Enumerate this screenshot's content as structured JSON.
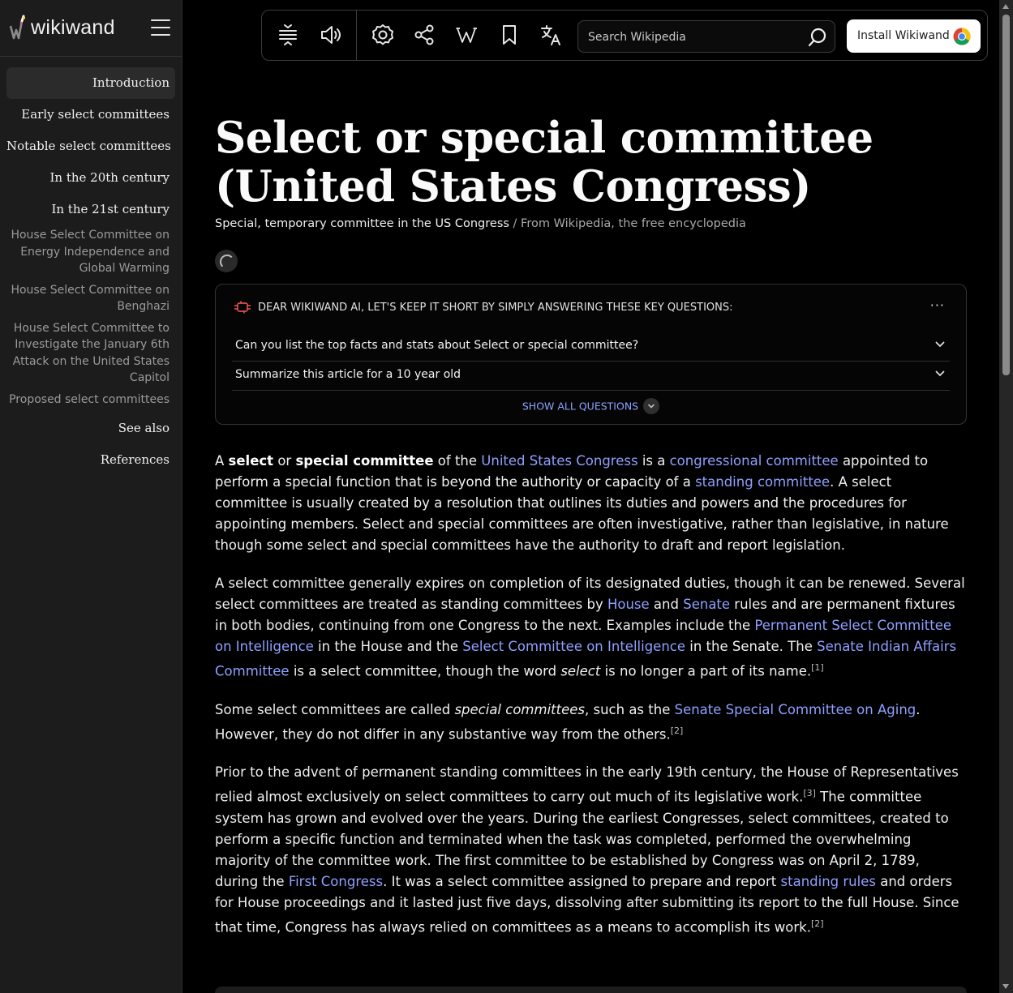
{
  "brand": {
    "name": "wikiwand"
  },
  "toc": {
    "items": [
      {
        "label": "Introduction",
        "level": 1,
        "active": true
      },
      {
        "label": "Early select committees",
        "level": 1
      },
      {
        "label": "Notable select committees",
        "level": 1
      },
      {
        "label": "In the 20th century",
        "level": 1
      },
      {
        "label": "In the 21st century",
        "level": 1
      },
      {
        "label": "House Select Committee on Energy Independence and Global Warming",
        "level": 2
      },
      {
        "label": "House Select Committee on Benghazi",
        "level": 2
      },
      {
        "label": "House Select Committee to Investigate the January 6th Attack on the United States Capitol",
        "level": 2
      },
      {
        "label": "Proposed select committees",
        "level": 2
      },
      {
        "label": "See also",
        "level": 1
      },
      {
        "label": "References",
        "level": 1
      }
    ]
  },
  "toolbar": {
    "icons": [
      "text-size-icon",
      "speaker-icon",
      "settings-gear-icon",
      "share-icon",
      "wikipedia-w-icon",
      "bookmark-icon",
      "translate-icon"
    ],
    "search_placeholder": "Search Wikipedia",
    "install_label": "Install Wikiwand"
  },
  "article": {
    "title": "Select or special committee (United States Congress)",
    "short_description": "Special, temporary committee in the US Congress",
    "source": " / From Wikipedia, the free encyclopedia"
  },
  "ai_box": {
    "header": "DEAR WIKIWAND AI, LET'S KEEP IT SHORT BY SIMPLY ANSWERING THESE KEY QUESTIONS:",
    "more": "···",
    "questions": [
      "Can you list the top facts and stats about Select or special committee?",
      "Summarize this article for a 10 year old"
    ],
    "show_all": "SHOW ALL QUESTIONS"
  },
  "paragraphs": {
    "p1": {
      "t1": "A ",
      "b1": "select",
      "t2": " or ",
      "b2": "special committee",
      "t3": " of the ",
      "l1": "United States Congress",
      "t4": " is a ",
      "l2": "congressional committee",
      "t5": " appointed to perform a special function that is beyond the authority or capacity of a ",
      "l3": "standing committee",
      "t6": ". A select committee is usually created by a resolution that outlines its duties and powers and the procedures for appointing members. Select and special committees are often investigative, rather than legislative, in nature though some select and special committees have the authority to draft and report legislation."
    },
    "p2": {
      "t1": "A select committee generally expires on completion of its designated duties, though it can be renewed. Several select committees are treated as standing committees by ",
      "l1": "House",
      "t2": " and ",
      "l2": "Senate",
      "t3": " rules and are permanent fixtures in both bodies, continuing from one Congress to the next. Examples include the ",
      "l3": "Permanent Select Committee on Intelligence",
      "t4": " in the House and the ",
      "l4": "Select Committee on Intelligence",
      "t5": " in the Senate. The ",
      "l5": "Senate Indian Affairs Committee",
      "t6": " is a select committee, though the word ",
      "i1": "select",
      "t7": " is no longer a part of its name.",
      "ref": "[1]"
    },
    "p3": {
      "t1": "Some select committees are called ",
      "i1": "special committees",
      "t2": ", such as the ",
      "l1": "Senate Special Committee on Aging",
      "t3": ". However, they do not differ in any substantive way from the others.",
      "ref": "[2]"
    },
    "p4": {
      "t1": "Prior to the advent of permanent standing committees in the early 19th century, the House of Representatives relied almost exclusively on select committees to carry out much of its legislative work.",
      "ref1": "[3]",
      "t2": " The committee system has grown and evolved over the years. During the earliest Congresses, select committees, created to perform a specific function and terminated when the task was completed, performed the overwhelming majority of the committee work. The first committee to be established by Congress was on April 2, 1789, during the ",
      "l1": "First Congress",
      "t3": ". It was a select committee assigned to prepare and report ",
      "l2": "standing rules",
      "t4": " and orders for House proceedings and it lasted just five days, dissolving after submitting its report to the full House. Since that time, Congress has always relied on committees as a means to accomplish its work.",
      "ref2": "[2]"
    }
  },
  "colors": {
    "background": "#000000",
    "sidebar": "#1c1c1c",
    "link": "#8fa0ff",
    "text": "#f0f0f0"
  }
}
